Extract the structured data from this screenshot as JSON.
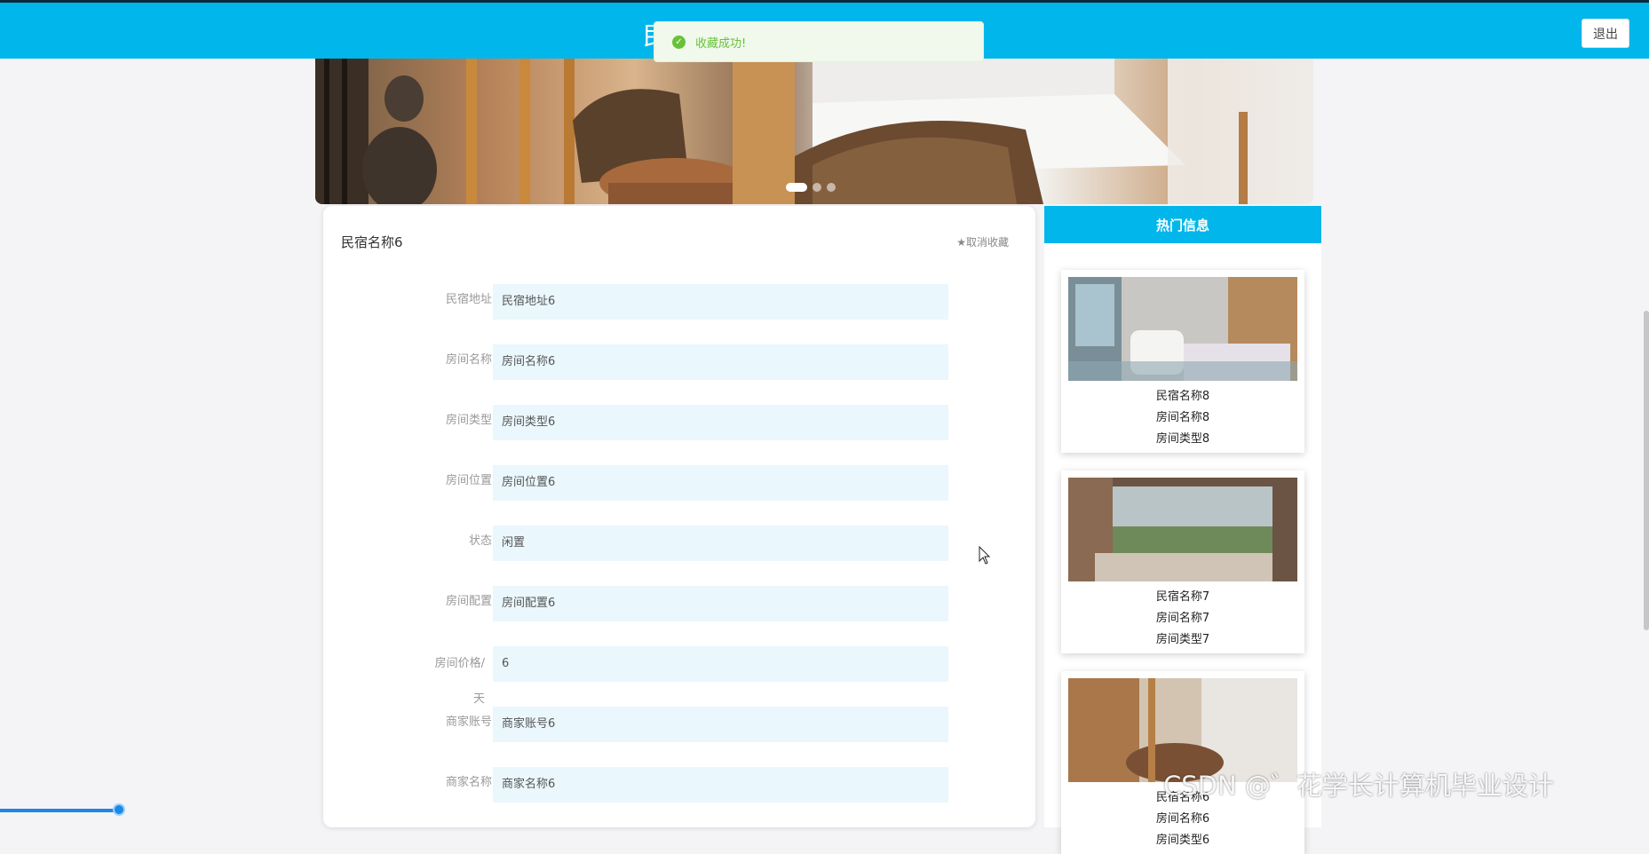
{
  "header": {
    "brand": "民",
    "logout_label": "退出"
  },
  "toast": {
    "message": "收藏成功!"
  },
  "carousel": {
    "total_slides": 3,
    "active_index": 0
  },
  "detail": {
    "title": "民宿名称6",
    "unfavorite_label": "★取消收藏",
    "fields": [
      {
        "label": "民宿地址",
        "value": "民宿地址6"
      },
      {
        "label": "房间名称",
        "value": "房间名称6"
      },
      {
        "label": "房间类型",
        "value": "房间类型6"
      },
      {
        "label": "房间位置",
        "value": "房间位置6"
      },
      {
        "label": "状态",
        "value": "闲置"
      },
      {
        "label": "房间配置",
        "value": "房间配置6"
      },
      {
        "label": "房间价格/天",
        "value": "6"
      },
      {
        "label": "商家账号",
        "value": "商家账号6"
      },
      {
        "label": "商家名称",
        "value": "商家名称6"
      }
    ]
  },
  "hot": {
    "title": "热门信息",
    "items": [
      {
        "homestay": "民宿名称8",
        "room": "房间名称8",
        "type": "房间类型8"
      },
      {
        "homestay": "民宿名称7",
        "room": "房间名称7",
        "type": "房间类型7"
      },
      {
        "homestay": "民宿名称6",
        "room": "房间名称6",
        "type": "房间类型6"
      }
    ]
  },
  "watermark": "CSDN @゛花学长计算机毕业设计",
  "colors": {
    "primary": "#00b6ea",
    "field_bg": "#eaf7fd",
    "success": "#67c23a"
  }
}
